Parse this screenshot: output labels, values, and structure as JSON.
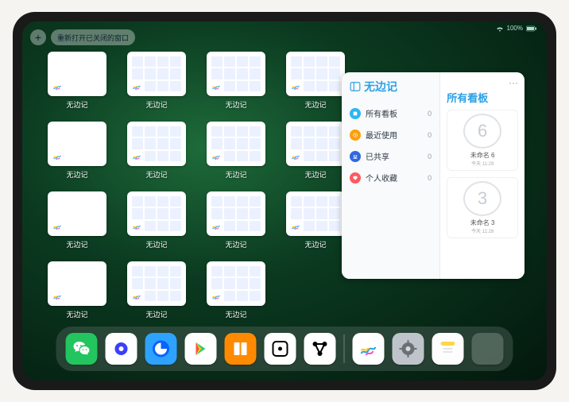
{
  "status": {
    "battery_label": "100%"
  },
  "top": {
    "plus": "+",
    "reopen_label": "重新打开已关闭的窗口"
  },
  "tiles": {
    "app_label": "无边记"
  },
  "panel": {
    "left": {
      "title": "无边记",
      "categories": [
        {
          "label": "所有看板",
          "count": "0",
          "color": "#2bb5f5"
        },
        {
          "label": "最近使用",
          "count": "0",
          "color": "#ff9f0a"
        },
        {
          "label": "已共享",
          "count": "0",
          "color": "#3068e0"
        },
        {
          "label": "个人收藏",
          "count": "0",
          "color": "#ff5a5f"
        }
      ]
    },
    "right": {
      "title": "所有看板",
      "more": "···",
      "boards": [
        {
          "glyph": "6",
          "label": "未命名 6",
          "time": "今天 11:29"
        },
        {
          "glyph": "3",
          "label": "未命名 3",
          "time": "今天 11:28"
        }
      ]
    }
  },
  "dock": {
    "apps": [
      {
        "name": "wechat",
        "bg": "#22c55e"
      },
      {
        "name": "quark",
        "bg": "#ffffff"
      },
      {
        "name": "qqbrowser",
        "bg": "#2ea2ff"
      },
      {
        "name": "play",
        "bg": "#ffffff"
      },
      {
        "name": "books",
        "bg": "#ff8a00"
      },
      {
        "name": "dice",
        "bg": "#ffffff"
      },
      {
        "name": "graph",
        "bg": "#ffffff"
      },
      {
        "name": "freeform",
        "bg": "#ffffff"
      },
      {
        "name": "settings",
        "bg": "#bfc4ca"
      },
      {
        "name": "notes",
        "bg": "#fdfdfd"
      }
    ]
  }
}
